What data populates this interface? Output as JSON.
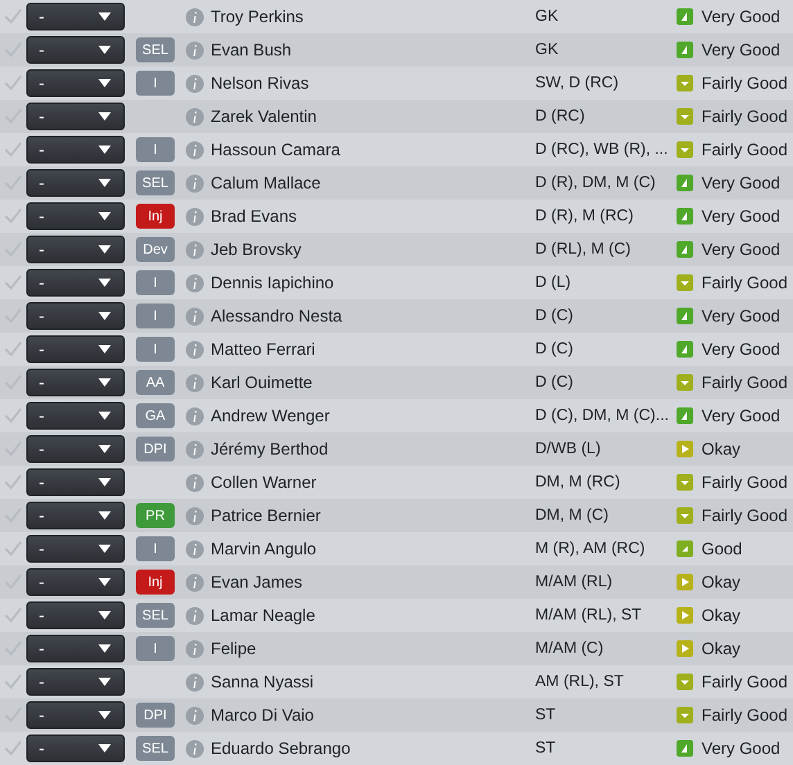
{
  "rows": [
    {
      "selection": "-",
      "badge": null,
      "name": "Troy Perkins",
      "position": "GK",
      "rating": {
        "kind": "very_good",
        "text": "Very Good"
      }
    },
    {
      "selection": "-",
      "badge": {
        "text": "SEL",
        "color": "#7d8894"
      },
      "name": "Evan Bush",
      "position": "GK",
      "rating": {
        "kind": "very_good",
        "text": "Very Good"
      }
    },
    {
      "selection": "-",
      "badge": {
        "text": "I",
        "color": "#7d8894"
      },
      "name": "Nelson Rivas",
      "position": "SW, D (RC)",
      "rating": {
        "kind": "fairly_good",
        "text": "Fairly Good"
      }
    },
    {
      "selection": "-",
      "badge": null,
      "name": "Zarek Valentin",
      "position": "D (RC)",
      "rating": {
        "kind": "fairly_good",
        "text": "Fairly Good"
      }
    },
    {
      "selection": "-",
      "badge": {
        "text": "I",
        "color": "#7d8894"
      },
      "name": "Hassoun Camara",
      "position": "D (RC), WB (R), ...",
      "rating": {
        "kind": "fairly_good",
        "text": "Fairly Good"
      }
    },
    {
      "selection": "-",
      "badge": {
        "text": "SEL",
        "color": "#7d8894"
      },
      "name": "Calum Mallace",
      "position": "D (R), DM, M (C)",
      "rating": {
        "kind": "very_good",
        "text": "Very Good"
      }
    },
    {
      "selection": "-",
      "badge": {
        "text": "Inj",
        "color": "#c41a1a"
      },
      "name": "Brad Evans",
      "position": "D (R), M (RC)",
      "rating": {
        "kind": "very_good",
        "text": "Very Good"
      }
    },
    {
      "selection": "-",
      "badge": {
        "text": "Dev",
        "color": "#7d8894"
      },
      "name": "Jeb Brovsky",
      "position": "D (RL), M (C)",
      "rating": {
        "kind": "very_good",
        "text": "Very Good"
      }
    },
    {
      "selection": "-",
      "badge": {
        "text": "I",
        "color": "#7d8894"
      },
      "name": "Dennis Iapichino",
      "position": "D (L)",
      "rating": {
        "kind": "fairly_good",
        "text": "Fairly Good"
      }
    },
    {
      "selection": "-",
      "badge": {
        "text": "I",
        "color": "#7d8894"
      },
      "name": "Alessandro Nesta",
      "position": "D (C)",
      "rating": {
        "kind": "very_good",
        "text": "Very Good"
      }
    },
    {
      "selection": "-",
      "badge": {
        "text": "I",
        "color": "#7d8894"
      },
      "name": "Matteo Ferrari",
      "position": "D (C)",
      "rating": {
        "kind": "very_good",
        "text": "Very Good"
      }
    },
    {
      "selection": "-",
      "badge": {
        "text": "AA",
        "color": "#7d8894"
      },
      "name": "Karl Ouimette",
      "position": "D (C)",
      "rating": {
        "kind": "fairly_good",
        "text": "Fairly Good"
      }
    },
    {
      "selection": "-",
      "badge": {
        "text": "GA",
        "color": "#7d8894"
      },
      "name": "Andrew Wenger",
      "position": "D (C), DM, M (C)...",
      "rating": {
        "kind": "very_good",
        "text": "Very Good"
      }
    },
    {
      "selection": "-",
      "badge": {
        "text": "DPI",
        "color": "#7d8894"
      },
      "name": "Jérémy Berthod",
      "position": "D/WB (L)",
      "rating": {
        "kind": "okay",
        "text": "Okay"
      }
    },
    {
      "selection": "-",
      "badge": null,
      "name": "Collen Warner",
      "position": "DM, M (RC)",
      "rating": {
        "kind": "fairly_good",
        "text": "Fairly Good"
      }
    },
    {
      "selection": "-",
      "badge": {
        "text": "PR",
        "color": "#3e9a3a"
      },
      "name": "Patrice Bernier",
      "position": "DM, M (C)",
      "rating": {
        "kind": "fairly_good",
        "text": "Fairly Good"
      }
    },
    {
      "selection": "-",
      "badge": {
        "text": "I",
        "color": "#7d8894"
      },
      "name": "Marvin Angulo",
      "position": "M (R), AM (RC)",
      "rating": {
        "kind": "good",
        "text": "Good"
      }
    },
    {
      "selection": "-",
      "badge": {
        "text": "Inj",
        "color": "#c41a1a"
      },
      "name": "Evan James",
      "position": "M/AM (RL)",
      "rating": {
        "kind": "okay",
        "text": "Okay"
      }
    },
    {
      "selection": "-",
      "badge": {
        "text": "SEL",
        "color": "#7d8894"
      },
      "name": "Lamar Neagle",
      "position": "M/AM (RL), ST",
      "rating": {
        "kind": "okay",
        "text": "Okay"
      }
    },
    {
      "selection": "-",
      "badge": {
        "text": "I",
        "color": "#7d8894"
      },
      "name": "Felipe",
      "position": "M/AM (C)",
      "rating": {
        "kind": "okay",
        "text": "Okay"
      }
    },
    {
      "selection": "-",
      "badge": null,
      "name": "Sanna Nyassi",
      "position": "AM (RL), ST",
      "rating": {
        "kind": "fairly_good",
        "text": "Fairly Good"
      }
    },
    {
      "selection": "-",
      "badge": {
        "text": "DPI",
        "color": "#7d8894"
      },
      "name": "Marco Di Vaio",
      "position": "ST",
      "rating": {
        "kind": "fairly_good",
        "text": "Fairly Good"
      }
    },
    {
      "selection": "-",
      "badge": {
        "text": "SEL",
        "color": "#7d8894"
      },
      "name": "Eduardo Sebrango",
      "position": "ST",
      "rating": {
        "kind": "very_good",
        "text": "Very Good"
      }
    }
  ]
}
